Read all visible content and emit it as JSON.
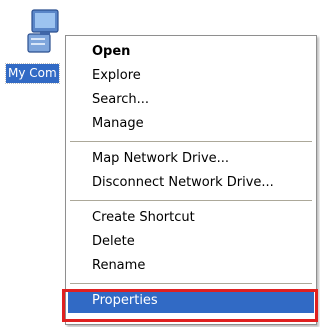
{
  "desktop": {
    "icon": {
      "label": "My Com",
      "icon_name": "my-computer-icon"
    }
  },
  "context_menu": {
    "groups": [
      [
        {
          "label": "Open",
          "bold": true
        },
        {
          "label": "Explore"
        },
        {
          "label": "Search..."
        },
        {
          "label": "Manage"
        }
      ],
      [
        {
          "label": "Map Network Drive..."
        },
        {
          "label": "Disconnect Network Drive..."
        }
      ],
      [
        {
          "label": "Create Shortcut"
        },
        {
          "label": "Delete"
        },
        {
          "label": "Rename"
        }
      ],
      [
        {
          "label": "Properties",
          "selected": true
        }
      ]
    ]
  },
  "colors": {
    "selection": "#316ac5",
    "highlight_box": "#e02020",
    "separator": "#aca899"
  }
}
